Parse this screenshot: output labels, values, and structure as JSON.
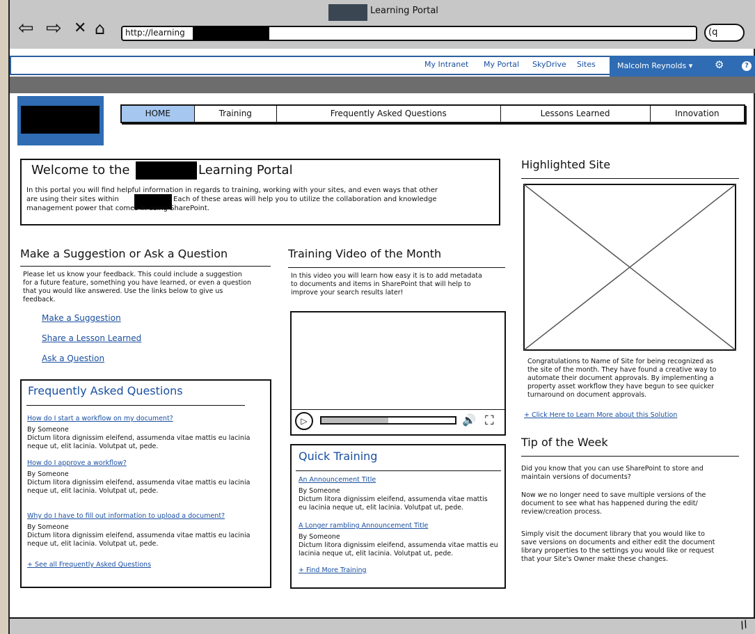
{
  "browser": {
    "window_title": "Learning Portal",
    "url": "http://learning",
    "nav_icons": [
      "back-arrow-icon",
      "forward-arrow-icon",
      "stop-icon",
      "home-icon"
    ],
    "search_glyph": "(q"
  },
  "sharepoint_bar": {
    "links": [
      "My Intranet",
      "My Portal",
      "SkyDrive",
      "Sites"
    ],
    "user": "Malcolm Reynolds",
    "user_chevron": "▾"
  },
  "topnav": [
    "HOME",
    "Training",
    "Frequently Asked Questions",
    "Lessons Learned",
    "Innovation"
  ],
  "welcome": {
    "title_part1": "Welcome to the",
    "title_part2": "Learning Portal",
    "line1": "In this portal you will find helpful information in regards to training, working with your sites, and even ways that other",
    "line2a": "are using their sites within",
    "line2b": "Each of these areas will help you to utilize the collaboration and knowledge",
    "line3": "management power that comes in using SharePoint."
  },
  "suggestion": {
    "title": "Make a Suggestion or Ask a Question",
    "body": [
      "Please let us know your feedback. This could include a suggestion",
      "for a future feature, something you have learned, or even a question",
      "that you would like answered. Use the links below to give us",
      "feedback."
    ],
    "links": [
      "Make a Suggestion",
      "Share a Lesson Learned",
      "Ask a Question"
    ]
  },
  "training_video": {
    "title": "Training Video of the Month",
    "body": [
      "In this video you will learn how easy it is to add metadata",
      "to documents and items in SharePoint that will help to",
      "improve your search results later!"
    ],
    "progress": 0.5
  },
  "faq": {
    "title": "Frequently Asked Questions",
    "items": [
      {
        "q": "How do I start a workflow on my document?",
        "by": "By Someone",
        "text1": "Dictum litora dignissim eleifend, assumenda vitae mattis eu lacinia",
        "text2": "neque ut, elit lacinia. Volutpat ut, pede."
      },
      {
        "q": "How do I approve a workflow?",
        "by": "By Someone",
        "text1": "Dictum litora dignissim eleifend, assumenda vitae mattis eu lacinia",
        "text2": "neque ut, elit lacinia. Volutpat ut, pede."
      },
      {
        "q": "Why do I have to fill out information to upload a document?",
        "by": "By Someone",
        "text1": "Dictum litora dignissim eleifend, assumenda vitae mattis eu lacinia",
        "text2": "neque ut, elit lacinia. Volutpat ut, pede."
      }
    ],
    "see_all": "+ See all Frequently Asked Questions"
  },
  "quick_training": {
    "title": "Quick Training",
    "items": [
      {
        "title": "An Announcement Title",
        "by": "By Someone",
        "text1": "Dictum litora dignissim eleifend, assumenda vitae mattis",
        "text2": "eu lacinia neque ut, elit lacinia. Volutpat ut, pede."
      },
      {
        "title": "A Longer rambling Announcement Title",
        "by": "By Someone",
        "text1": "Dictum litora dignissim eleifend, assumenda vitae mattis eu",
        "text2": "lacinia neque ut, elit lacinia. Volutpat ut, pede."
      }
    ],
    "more": "+ Find More Training"
  },
  "highlighted": {
    "title": "Highlighted Site",
    "body": [
      "Congratulations to Name of Site for being recognized as",
      "the site of the month. They have found a creative way to",
      "automate their document approvals. By implementing a",
      "property asset workflow they have begun to see quicker",
      "turnaround on document approvals."
    ],
    "link": "+ Click Here to Learn More about this Solution"
  },
  "tip": {
    "title": "Tip of the Week",
    "p1": [
      "Did you know that you can use SharePoint to store and",
      "maintain versions of documents?"
    ],
    "p2": [
      "Now we no longer need to save multiple versions of the",
      "document to see what has happened during the edit/",
      "review/creation process."
    ],
    "p3": [
      "Simply visit the document library that you would like to",
      "save versions on documents and either edit the document",
      "library properties to the settings you would like or request",
      "that your Site's Owner make these changes."
    ]
  }
}
